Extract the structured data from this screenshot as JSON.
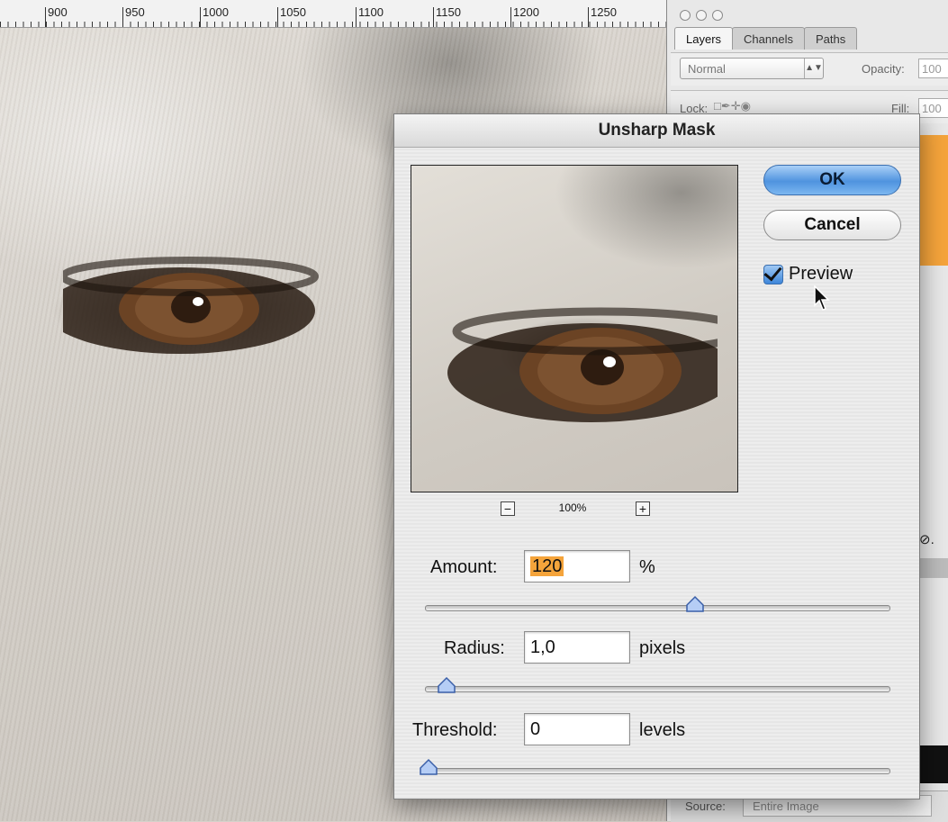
{
  "ruler": {
    "labels": [
      "900",
      "950",
      "1000",
      "1050",
      "1100",
      "1150",
      "1200",
      "1250"
    ]
  },
  "layers_panel": {
    "tabs": [
      "Layers",
      "Channels",
      "Paths"
    ],
    "blend_mode": "Normal",
    "opacity_label": "Opacity:",
    "opacity_value": "100",
    "lock_label": "Lock:",
    "fill_label": "Fill:",
    "fill_value": "100",
    "source_label": "Source:",
    "source_value": "Entire Image",
    "tool_glyph": "⊘."
  },
  "dialog": {
    "title": "Unsharp Mask",
    "ok_label": "OK",
    "cancel_label": "Cancel",
    "preview_label": "Preview",
    "preview_checked": true,
    "zoom_level": "100%",
    "zoom_out_glyph": "−",
    "zoom_in_glyph": "+",
    "amount": {
      "label": "Amount:",
      "value": "120",
      "unit": "%",
      "slider_fraction": 0.6
    },
    "radius": {
      "label": "Radius:",
      "value": "1,0",
      "unit": "pixels",
      "slider_fraction": 0.04
    },
    "threshold": {
      "label": "Threshold:",
      "value": "0",
      "unit": "levels",
      "slider_fraction": 0.0
    }
  },
  "colors": {
    "accent": "#4f93df",
    "highlight": "#f5a43b"
  }
}
